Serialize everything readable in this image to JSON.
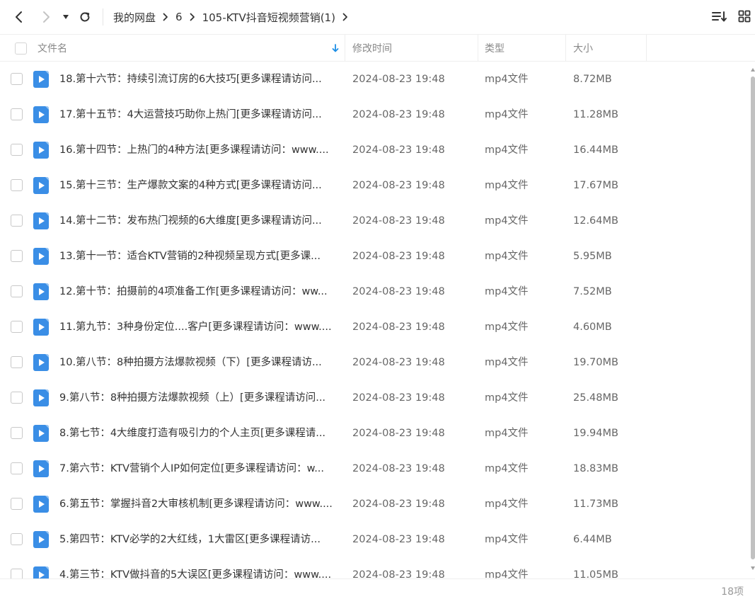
{
  "breadcrumb": [
    {
      "label": "我的网盘"
    },
    {
      "label": "6"
    },
    {
      "label": "105-KTV抖音短视频营销(1)"
    }
  ],
  "columns": {
    "name": "文件名",
    "modified": "修改时间",
    "type": "类型",
    "size": "大小"
  },
  "colors": {
    "accent": "#1e8fe6",
    "file_icon": "#3a8ee6"
  },
  "files": [
    {
      "name": "18.第十六节：持续引流订房的6大技巧[更多课程请访问...",
      "modified": "2024-08-23 19:48",
      "type": "mp4文件",
      "size": "8.72MB"
    },
    {
      "name": "17.第十五节：4大运营技巧助你上热门[更多课程请访问...",
      "modified": "2024-08-23 19:48",
      "type": "mp4文件",
      "size": "11.28MB"
    },
    {
      "name": "16.第十四节：上热门的4种方法[更多课程请访问：www....",
      "modified": "2024-08-23 19:48",
      "type": "mp4文件",
      "size": "16.44MB"
    },
    {
      "name": "15.第十三节：生产爆款文案的4种方式[更多课程请访问...",
      "modified": "2024-08-23 19:48",
      "type": "mp4文件",
      "size": "17.67MB"
    },
    {
      "name": "14.第十二节：发布热门视频的6大维度[更多课程请访问...",
      "modified": "2024-08-23 19:48",
      "type": "mp4文件",
      "size": "12.64MB"
    },
    {
      "name": "13.第十一节：适合KTV营销的2种视频呈现方式[更多课...",
      "modified": "2024-08-23 19:48",
      "type": "mp4文件",
      "size": "5.95MB"
    },
    {
      "name": "12.第十节：拍摄前的4项准备工作[更多课程请访问：ww...",
      "modified": "2024-08-23 19:48",
      "type": "mp4文件",
      "size": "7.52MB"
    },
    {
      "name": "11.第九节：3种身份定位....客户[更多课程请访问：www....",
      "modified": "2024-08-23 19:48",
      "type": "mp4文件",
      "size": "4.60MB"
    },
    {
      "name": "10.第八节：8种拍摄方法爆款视频（下）[更多课程请访...",
      "modified": "2024-08-23 19:48",
      "type": "mp4文件",
      "size": "19.70MB"
    },
    {
      "name": "9.第八节：8种拍摄方法爆款视频（上）[更多课程请访问...",
      "modified": "2024-08-23 19:48",
      "type": "mp4文件",
      "size": "25.48MB"
    },
    {
      "name": "8.第七节：4大维度打造有吸引力的个人主页[更多课程请...",
      "modified": "2024-08-23 19:48",
      "type": "mp4文件",
      "size": "19.94MB"
    },
    {
      "name": "7.第六节：KTV营销个人IP如何定位[更多课程请访问：w...",
      "modified": "2024-08-23 19:48",
      "type": "mp4文件",
      "size": "18.83MB"
    },
    {
      "name": "6.第五节：掌握抖音2大审核机制[更多课程请访问：www....",
      "modified": "2024-08-23 19:48",
      "type": "mp4文件",
      "size": "11.73MB"
    },
    {
      "name": "5.第四节：KTV必学的2大红线，1大雷区[更多课程请访...",
      "modified": "2024-08-23 19:48",
      "type": "mp4文件",
      "size": "6.44MB"
    },
    {
      "name": "4.第三节：KTV做抖音的5大误区[更多课程请访问：www....",
      "modified": "2024-08-23 19:48",
      "type": "mp4文件",
      "size": "11.05MB"
    }
  ],
  "footer": {
    "count": "18项"
  }
}
